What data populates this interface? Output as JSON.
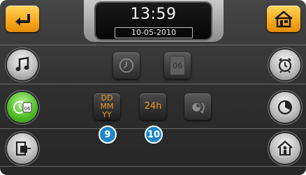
{
  "header": {
    "time": "13:59",
    "date": "10-05-2010"
  },
  "buttons": {
    "back_icon": "back-arrow-icon",
    "home_icon": "home-icon"
  },
  "left_menu": [
    {
      "icon": "music-note-icon",
      "active": false
    },
    {
      "icon": "clock-calendar-icon",
      "active": true,
      "text": "06"
    },
    {
      "icon": "door-exit-icon",
      "active": false
    }
  ],
  "right_menu": [
    {
      "icon": "alarm-clock-icon"
    },
    {
      "icon": "timer-icon"
    },
    {
      "icon": "house-person-icon"
    }
  ],
  "settings": {
    "clock_button_icon": "analog-clock-icon",
    "calendar_button_text": "06",
    "date_format": {
      "line1": "DD",
      "line2": "MM",
      "line3": "YY"
    },
    "time_format": "24h",
    "sync_icon": "clock-sync-icon"
  },
  "badges": {
    "date_format_badge": "9",
    "time_format_badge": "10"
  },
  "colors": {
    "accent_orange": "#f29a23",
    "badge_blue": "#1e86c9",
    "active_green": "#52c12a"
  }
}
